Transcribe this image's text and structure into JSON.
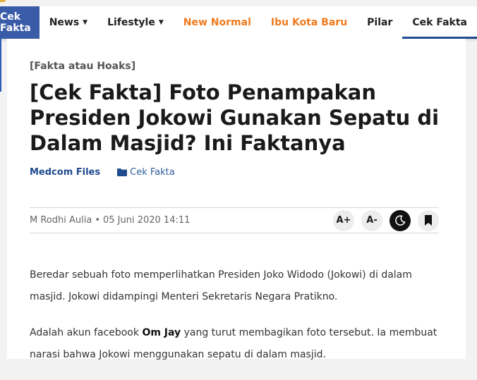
{
  "nav": {
    "brand": "Cek Fakta",
    "items": [
      {
        "label": "News",
        "dropdown": true,
        "style": "normal"
      },
      {
        "label": "Lifestyle",
        "dropdown": true,
        "style": "normal"
      },
      {
        "label": "New Normal",
        "dropdown": false,
        "style": "orange"
      },
      {
        "label": "Ibu Kota Baru",
        "dropdown": false,
        "style": "orange"
      },
      {
        "label": "Pilar",
        "dropdown": false,
        "style": "normal"
      },
      {
        "label": "Cek Fakta",
        "dropdown": false,
        "style": "active"
      }
    ]
  },
  "article": {
    "kicker": "[Fakta atau Hoaks]",
    "title": "[Cek Fakta] Foto Penampakan Presiden Jokowi Gunakan Sepatu di Dalam Masjid? Ini Faktanya",
    "source": "Medcom Files",
    "category": "Cek Fakta",
    "author": "M Rodhi Aulia",
    "separator": "•",
    "date": "05 Juni 2020 14:11",
    "tools": {
      "font_increase": "A+",
      "font_decrease": "A-"
    },
    "paragraph1": "Beredar sebuah foto memperlihatkan Presiden Joko Widodo (Jokowi) di dalam masjid. Jokowi didampingi Menteri Sekretaris Negara Pratikno.",
    "paragraph2_pre": "Adalah akun facebook ",
    "paragraph2_bold": "Om Jay",
    "paragraph2_post": " yang turut membagikan foto tersebut. Ia membuat narasi bahwa Jokowi menggunakan sepatu di dalam masjid."
  },
  "colors": {
    "brand": "#3a5ca8",
    "accent_orange": "#f07a1e",
    "link_blue": "#1f4b8f"
  }
}
